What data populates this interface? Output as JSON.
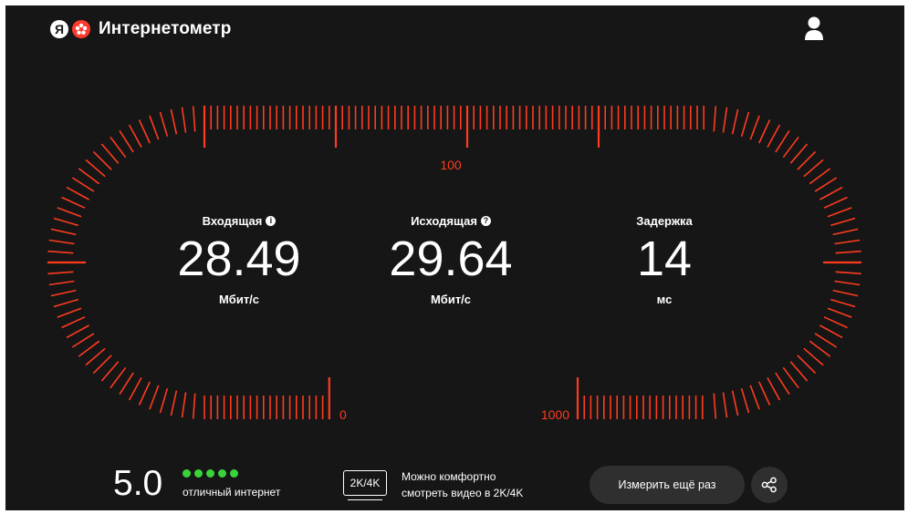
{
  "header": {
    "logo_letter": "Я",
    "app_title": "Интернетометр",
    "user_icon": "user-icon"
  },
  "gauge": {
    "accent_color": "#ff3b1f",
    "scale_labels": [
      "0",
      "100",
      "1000"
    ]
  },
  "metrics": {
    "download": {
      "label": "Входящая",
      "value": "28.49",
      "unit": "Мбит/с",
      "icon": "info-icon"
    },
    "upload": {
      "label": "Исходящая",
      "value": "29.64",
      "unit": "Мбит/с",
      "icon": "help-icon"
    },
    "latency": {
      "label": "Задержка",
      "value": "14",
      "unit": "мс"
    }
  },
  "rating": {
    "score": "5.0",
    "stars": 5,
    "stars_max": 5,
    "dot_color": "#3ad43a",
    "text": "отличный интернет"
  },
  "video": {
    "badge": "2K/4K",
    "line1": "Можно комфортно",
    "line2": "смотреть видео в 2K/4K"
  },
  "actions": {
    "retest_label": "Измерить ещё раз",
    "share_icon": "share-icon"
  }
}
